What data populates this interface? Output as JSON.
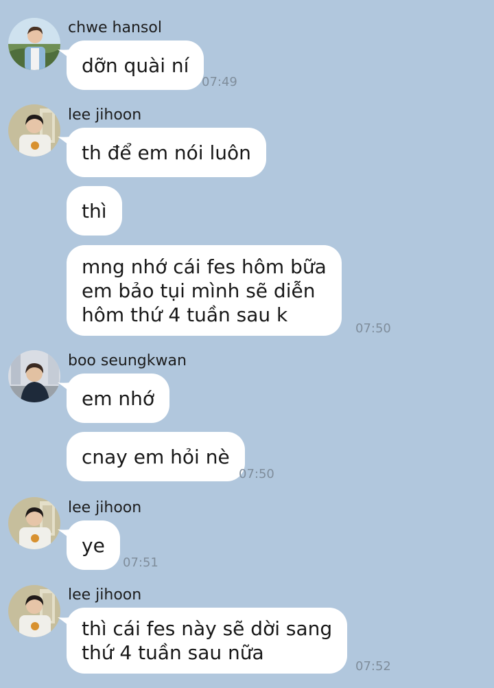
{
  "messages": [
    {
      "sender": "chwe hansol",
      "lines": [
        "dỡn quài ní"
      ],
      "time": "07:49"
    },
    {
      "sender": "lee jihoon",
      "lines": [
        "th để em nói luôn"
      ]
    },
    {
      "lines": [
        "thì"
      ]
    },
    {
      "lines": [
        "mng nhớ cái fes hôm bữa",
        "em bảo tụi mình sẽ diễn",
        "hôm thứ 4 tuần sau k"
      ],
      "time": "07:50"
    },
    {
      "sender": "boo seungkwan",
      "lines": [
        "em nhớ"
      ]
    },
    {
      "lines": [
        "cnay em hỏi nè"
      ],
      "time": "07:50"
    },
    {
      "sender": "lee jihoon",
      "lines": [
        "ye"
      ],
      "time": "07:51"
    },
    {
      "sender": "lee jihoon",
      "lines": [
        "thì cái fes này sẽ dời sang",
        "thứ 4 tuần sau nữa"
      ],
      "time": "07:52"
    }
  ]
}
